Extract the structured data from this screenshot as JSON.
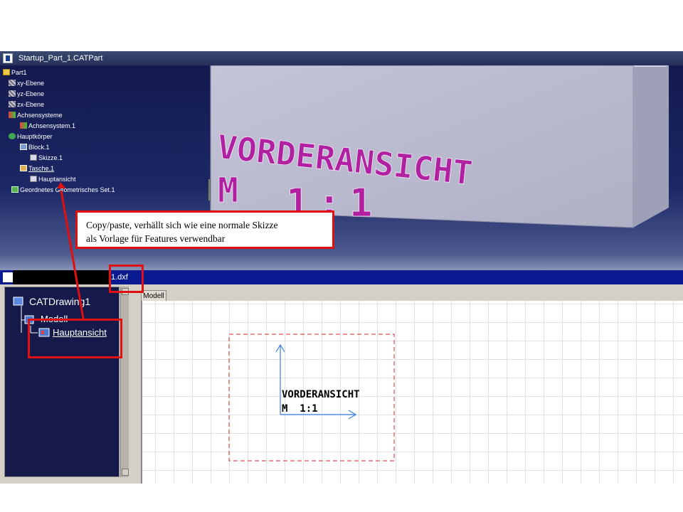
{
  "top_window": {
    "title": "Startup_Part_1.CATPart",
    "tree": [
      {
        "label": "Part1",
        "icon": "part-icon"
      },
      {
        "label": "xy-Ebene",
        "icon": "plane-icon"
      },
      {
        "label": "yz-Ebene",
        "icon": "plane-icon"
      },
      {
        "label": "zx-Ebene",
        "icon": "plane-icon"
      },
      {
        "label": "Achsensysteme",
        "icon": "axis-systems-icon"
      },
      {
        "label": "Achsensystem.1",
        "icon": "axis-system-icon"
      },
      {
        "label": "Hauptkörper",
        "icon": "body-icon"
      },
      {
        "label": "Block.1",
        "icon": "pad-icon"
      },
      {
        "label": "Skizze.1",
        "icon": "sketch-icon"
      },
      {
        "label": "Tasche.1",
        "icon": "pocket-icon"
      },
      {
        "label": "Hauptansicht",
        "icon": "sketch-icon"
      },
      {
        "label": "Geordnetes Geometrisches Set.1",
        "icon": "geometrical-set-icon"
      }
    ],
    "model_text_line1": "VORDERANSICHT",
    "model_text_line2_m": "M",
    "model_text_line2_scale": "1:1"
  },
  "annotation": {
    "line1": "Copy/paste, verhällt sich wie eine normale Skizze",
    "line2": "als Vorlage für Features verwendbar"
  },
  "bottom_window": {
    "title": "1.dxf",
    "tree": {
      "root": "CATDrawing1",
      "child": "Modell",
      "grandchild": "Hauptansicht"
    },
    "sheet_tab": "Modell",
    "view_text_line1": "VORDERANSICHT",
    "view_text_line2": "M  1:1"
  },
  "colors": {
    "highlight_red": "#e01010",
    "tree_background": "#161a4a",
    "engraving_magenta": "#b020a0",
    "axis_blue": "#3a7ee0"
  }
}
